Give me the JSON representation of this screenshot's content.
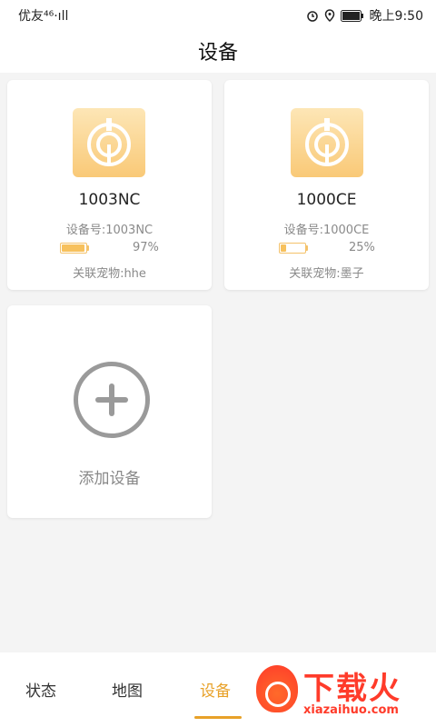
{
  "status_bar": {
    "carrier": "优友⁴⁶·ıll",
    "time": "晚上9:50"
  },
  "header": {
    "title": "设备"
  },
  "devices": [
    {
      "name": "1003NC",
      "device_no": "设备号:1003NC",
      "battery": "97%",
      "battery_level": 0.97,
      "pet": "关联宠物:hhe"
    },
    {
      "name": "1000CE",
      "device_no": "设备号:1000CE",
      "battery": "25%",
      "battery_level": 0.25,
      "pet": "关联宠物:墨子"
    }
  ],
  "add_device": {
    "label": "添加设备"
  },
  "tabs": [
    {
      "label": "状态",
      "active": false
    },
    {
      "label": "地图",
      "active": false
    },
    {
      "label": "设备",
      "active": true
    }
  ],
  "watermark": {
    "brand": "下载火",
    "domain": "xiazaihuo.com"
  },
  "colors": {
    "accent": "#e8a128",
    "icon_bg": "#f9c977",
    "battery": "#f7c15d"
  }
}
